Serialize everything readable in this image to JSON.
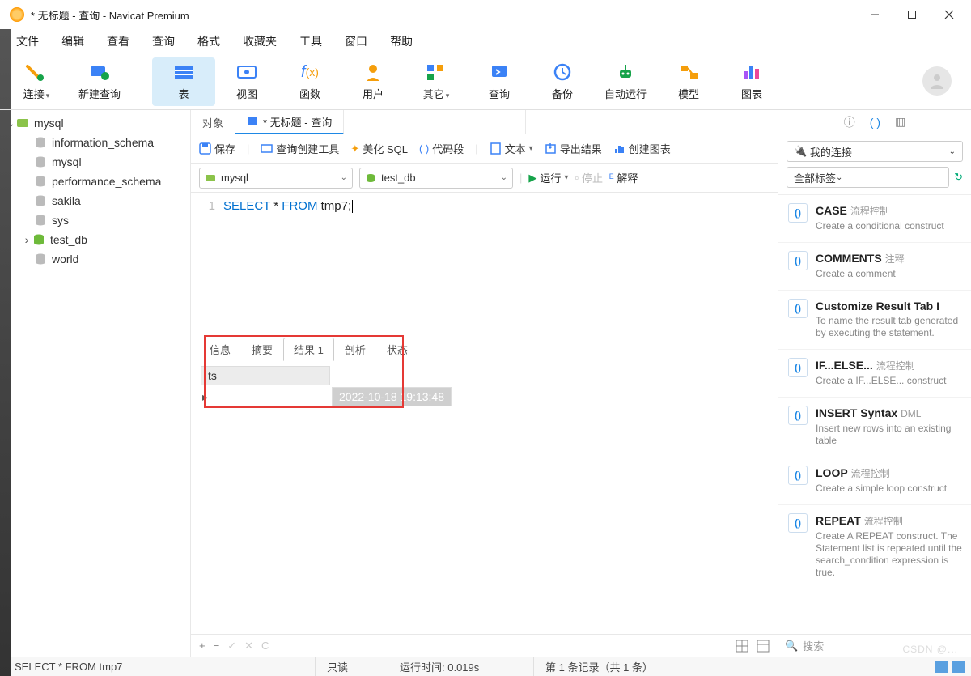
{
  "window": {
    "title": "* 无标题 - 查询 - Navicat Premium"
  },
  "menu": {
    "items": [
      "文件",
      "编辑",
      "查看",
      "查询",
      "格式",
      "收藏夹",
      "工具",
      "窗口",
      "帮助"
    ]
  },
  "toolbar": {
    "items": [
      {
        "label": "连接",
        "dd": true
      },
      {
        "label": "新建查询"
      },
      {
        "label": "表",
        "active": true
      },
      {
        "label": "视图"
      },
      {
        "label": "函数"
      },
      {
        "label": "用户"
      },
      {
        "label": "其它",
        "dd": true
      },
      {
        "label": "查询"
      },
      {
        "label": "备份"
      },
      {
        "label": "自动运行"
      },
      {
        "label": "模型"
      },
      {
        "label": "图表"
      }
    ]
  },
  "sidebar": {
    "connection": "mysql",
    "dbs": [
      "information_schema",
      "mysql",
      "performance_schema",
      "sakila",
      "sys",
      "test_db",
      "world"
    ],
    "expandable": "test_db"
  },
  "tabs": {
    "obj": "对象",
    "query": "* 无标题 - 查询"
  },
  "querybar": {
    "save": "保存",
    "builder": "查询创建工具",
    "beautify": "美化 SQL",
    "snippets": "代码段",
    "text": "文本",
    "export": "导出结果",
    "chart": "创建图表"
  },
  "drops": {
    "conn": "mysql",
    "db": "test_db",
    "run": "运行",
    "stop": "停止",
    "explain": "解释"
  },
  "sql": {
    "line": "1",
    "select": "SELECT",
    "star": "*",
    "from": "FROM",
    "rest": "tmp7;"
  },
  "result_tabs": [
    "信息",
    "摘要",
    "结果 1",
    "剖析",
    "状态"
  ],
  "result_active": 2,
  "result": {
    "col": "ts",
    "row": "2022-10-18 19:13:48"
  },
  "result_footer": {
    "add": "+",
    "del": "−",
    "apply": "✓",
    "cancel": "✕",
    "refresh": "C"
  },
  "rightpanel": {
    "conn_drop": "我的连接",
    "tags_drop": "全部标签",
    "snippets": [
      {
        "title": "CASE",
        "tag": "流程控制",
        "desc": "Create a conditional construct"
      },
      {
        "title": "COMMENTS",
        "tag": "注释",
        "desc": "Create a comment"
      },
      {
        "title": "Customize Result Tab I",
        "tag": "",
        "desc": "To name the result tab generated by executing the statement."
      },
      {
        "title": "IF...ELSE...",
        "tag": "流程控制",
        "desc": "Create a IF...ELSE... construct"
      },
      {
        "title": "INSERT Syntax",
        "tag": "DML",
        "desc": "Insert new rows into an existing table"
      },
      {
        "title": "LOOP",
        "tag": "流程控制",
        "desc": "Create a simple loop construct"
      },
      {
        "title": "REPEAT",
        "tag": "流程控制",
        "desc": "Create A REPEAT construct. The Statement list is repeated until the search_condition expression is true."
      }
    ],
    "search": "搜索"
  },
  "status": {
    "query": "SELECT * FROM tmp7",
    "readonly": "只读",
    "runtime": "运行时间: 0.019s",
    "records": "第 1 条记录（共 1 条）"
  },
  "watermark": "CSDN @..."
}
